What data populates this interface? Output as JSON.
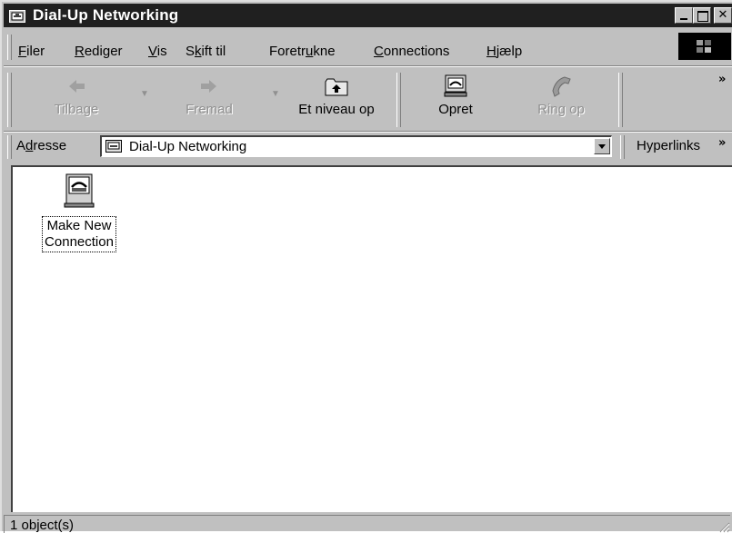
{
  "window": {
    "title": "Dial-Up Networking",
    "icon": "dialup-folder-icon",
    "controls": [
      "minimize",
      "maximize",
      "close"
    ]
  },
  "menu": {
    "items": [
      {
        "pre": "",
        "ul": "F",
        "post": "iler"
      },
      {
        "pre": "",
        "ul": "R",
        "post": "ediger"
      },
      {
        "pre": "",
        "ul": "V",
        "post": "is"
      },
      {
        "pre": "S",
        "ul": "k",
        "post": "ift til"
      },
      {
        "pre": "Foretr",
        "ul": "u",
        "post": "kne"
      },
      {
        "pre": "",
        "ul": "C",
        "post": "onnections"
      },
      {
        "pre": "",
        "ul": "H",
        "post": "jælp"
      }
    ],
    "logo": "windows-flag-icon"
  },
  "toolbar": {
    "back": "Tilbage",
    "forward": "Fremad",
    "up": "Et niveau op",
    "create": "Opret",
    "dial": "Ring op",
    "more": "»"
  },
  "address": {
    "label_pre": "A",
    "label_ul": "d",
    "label_post": "resse",
    "value": "Dial-Up Networking",
    "links": "Hyperlinks",
    "links_more": "»"
  },
  "content": {
    "items": [
      {
        "label_line1": "Make New",
        "label_line2": "Connection",
        "icon": "make-new-connection-icon"
      }
    ]
  },
  "status": {
    "text": "1 object(s)"
  },
  "colors": {
    "titlebar": "#202020",
    "face": "#c0c0c0",
    "content_bg": "#ffffff"
  }
}
